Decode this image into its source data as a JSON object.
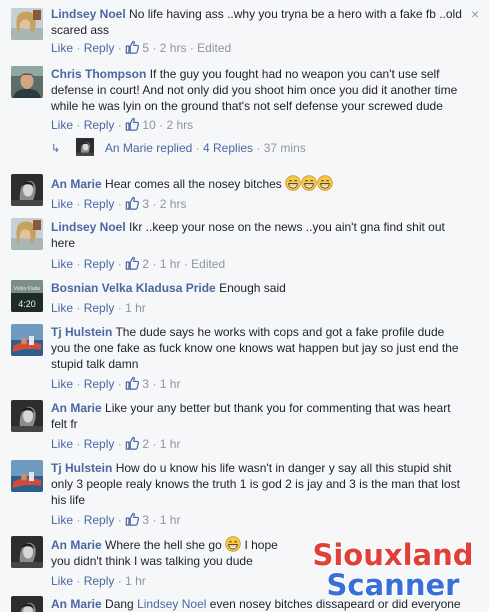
{
  "comments": [
    {
      "name": "Lindsey Noel",
      "text": "No life having ass ..why you tryna be a hero with a fake fb ..old scared ass",
      "like": "Like",
      "reply": "Reply",
      "likes": "5",
      "time": "2 hrs",
      "edited": "Edited"
    },
    {
      "name": "Chris Thompson",
      "text": "If the guy you fought had no weapon you can't use self defense in court! And not only did you shoot him once you did it another time while he was lyin on the ground that's not self defense your screwed dude",
      "like": "Like",
      "reply": "Reply",
      "likes": "10",
      "time": "2 hrs"
    },
    {
      "name": "An Marie",
      "text": "Hear comes all the nosey bitches",
      "like": "Like",
      "reply": "Reply",
      "likes": "3",
      "time": "2 hrs"
    },
    {
      "name": "Lindsey Noel",
      "text": "Ikr ..keep your nose on the news ..you ain't gna find shit out here",
      "like": "Like",
      "reply": "Reply",
      "likes": "2",
      "time": "1 hr",
      "edited": "Edited"
    },
    {
      "name": "Bosnian Velka Kladusa Pride",
      "text": "Enough said",
      "like": "Like",
      "reply": "Reply",
      "time": "1 hr"
    },
    {
      "name": "Tj Hulstein",
      "text": "The dude says he works with cops and got a fake profile dude you the one fake as fuck know one knows wat happen but jay so just end the stupid talk damn",
      "like": "Like",
      "reply": "Reply",
      "likes": "3",
      "time": "1 hr"
    },
    {
      "name": "An Marie",
      "text": "Like your any better but thank you for commenting that was heart felt fr",
      "like": "Like",
      "reply": "Reply",
      "likes": "2",
      "time": "1 hr"
    },
    {
      "name": "Tj Hulstein",
      "text": "How do u know his life wasn't in danger y say all this stupid shit only 3 people realy knows the truth 1 is god 2 is jay and 3 is the man that lost his life",
      "like": "Like",
      "reply": "Reply",
      "likes": "3",
      "time": "1 hr"
    },
    {
      "name": "An Marie",
      "text_a": "Where the hell she go",
      "text_b": "I hope you didn't think I was talking you dude",
      "like": "Like",
      "reply": "Reply",
      "time": "1 hr"
    },
    {
      "name": "An Marie",
      "text_a": "Dang",
      "mention": "Lindsey Noel",
      "text_b": "even nosey bitches dissapeard or did everyone"
    }
  ],
  "reply_summary": {
    "name": "An Marie",
    "verb": "replied",
    "count": "4 Replies",
    "time": "37 mins"
  },
  "close_glyph": "×",
  "separator": "·",
  "watermark": {
    "line1": "Siouxland",
    "line2": "Scanner"
  },
  "avatar_thumbnail_text": {
    "top": "Velka Kladu",
    "time": "4:20"
  },
  "colors": {
    "link": "#4b67a1",
    "meta": "#90949c",
    "background": "#f6f7f9",
    "text": "#1d2129",
    "watermark_red": "#e0403a",
    "watermark_blue": "#3b6fd8"
  }
}
